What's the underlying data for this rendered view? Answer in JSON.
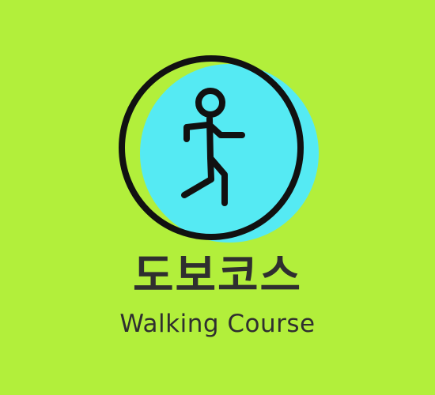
{
  "logo": {
    "title_ko": "도보코스",
    "title_en": "Walking Course",
    "icon": "walking-person-icon"
  },
  "colors": {
    "background": "#b2ef3b",
    "circle_fill": "#55eaf3",
    "outline": "#111111",
    "text": "#2f2f2f"
  }
}
